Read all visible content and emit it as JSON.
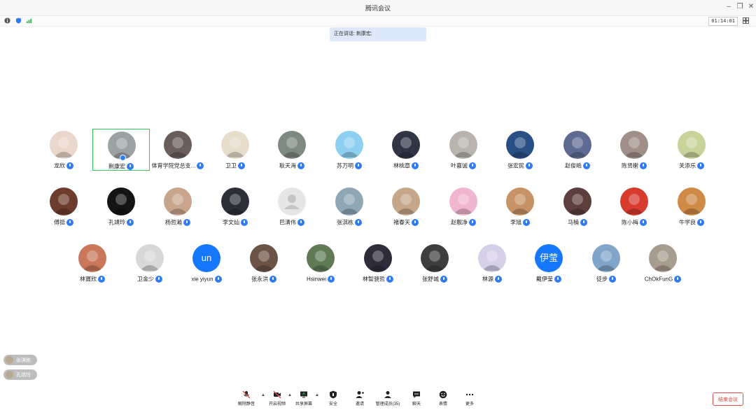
{
  "window": {
    "title": "腾讯会议",
    "timer": "01:14:01"
  },
  "speaking_banner": "正在讲话: 荆康宏;",
  "colors": {
    "accent": "#2f7cf6",
    "active_border": "#3cbf5c",
    "end_button": "#e04b4b"
  },
  "participants_row1": [
    {
      "name": "龙欣",
      "avatar_color": "#e9d7cc"
    },
    {
      "name": "荆康宏",
      "avatar_color": "#9aa2a3",
      "active": true
    },
    {
      "name": "体育学院党总支...",
      "avatar_color": "#6a5d5a"
    },
    {
      "name": "卫卫",
      "avatar_color": "#e8dccb"
    },
    {
      "name": "耿天海",
      "avatar_color": "#7d8a7f"
    },
    {
      "name": "苏万明",
      "avatar_color": "#8ed0f0"
    },
    {
      "name": "林桃章",
      "avatar_color": "#2f3544"
    },
    {
      "name": "叶嘉诚",
      "avatar_color": "#b8b3ad"
    },
    {
      "name": "张宏民",
      "avatar_color": "#2a4f86"
    },
    {
      "name": "赵俊皓",
      "avatar_color": "#5f6a92"
    },
    {
      "name": "陈贤榭",
      "avatar_color": "#9f8f86"
    },
    {
      "name": "关添乐",
      "avatar_color": "#c8d39a"
    }
  ],
  "participants_row2": [
    {
      "name": "傅挺",
      "avatar_color": "#6c3c2c"
    },
    {
      "name": "孔靖玲",
      "avatar_color": "#141414"
    },
    {
      "name": "杨哲瀚",
      "avatar_color": "#c9a58c"
    },
    {
      "name": "李文灿",
      "avatar_color": "#2b2f38"
    },
    {
      "name": "巴清伟",
      "avatar_color": "#e6e6e6",
      "default_avatar": true
    },
    {
      "name": "张淇栋",
      "avatar_color": "#8fa6b5"
    },
    {
      "name": "褚春天",
      "avatar_color": "#c6a78a"
    },
    {
      "name": "赵靓净",
      "avatar_color": "#f0b6cf"
    },
    {
      "name": "李旭",
      "avatar_color": "#c79366"
    },
    {
      "name": "马楠",
      "avatar_color": "#5c3f3a"
    },
    {
      "name": "陈小梅",
      "avatar_color": "#d83a2e"
    },
    {
      "name": "牛学良",
      "avatar_color": "#cf8a45"
    }
  ],
  "participants_row3": [
    {
      "name": "林寶欣",
      "avatar_color": "#c9785a"
    },
    {
      "name": "卫金少",
      "avatar_color": "#d8d8d8"
    },
    {
      "name": "xie yiyun",
      "avatar_color": "#1677ff",
      "initials": "un"
    },
    {
      "name": "张永洪",
      "avatar_color": "#6b5346"
    },
    {
      "name": "Hsinwei",
      "avatar_color": "#5f7a55"
    },
    {
      "name": "林智骁哲",
      "avatar_color": "#2f2b3a"
    },
    {
      "name": "张舒城",
      "avatar_color": "#3e3e3e"
    },
    {
      "name": "林源",
      "avatar_color": "#d6cfe8"
    },
    {
      "name": "戴伊莹",
      "avatar_color": "#1677ff",
      "initials": "伊莹"
    },
    {
      "name": "徒步",
      "avatar_color": "#7fa6c9"
    },
    {
      "name": "ChOkFunG",
      "avatar_color": "#a89b90"
    }
  ],
  "toasts": [
    "张淇栋",
    "孔靖玲"
  ],
  "toolbar": {
    "mute": "解除静音",
    "video": "开启视频",
    "share": "共享屏幕",
    "security": "安全",
    "invite": "邀请",
    "members": "管理成员(35)",
    "chat": "聊天",
    "reactions": "表情",
    "more": "更多"
  },
  "end_button": "结束会议",
  "icons": {
    "info": "info-icon",
    "shield": "shield-icon",
    "signal": "signal-icon",
    "grid": "grid-view-icon"
  }
}
